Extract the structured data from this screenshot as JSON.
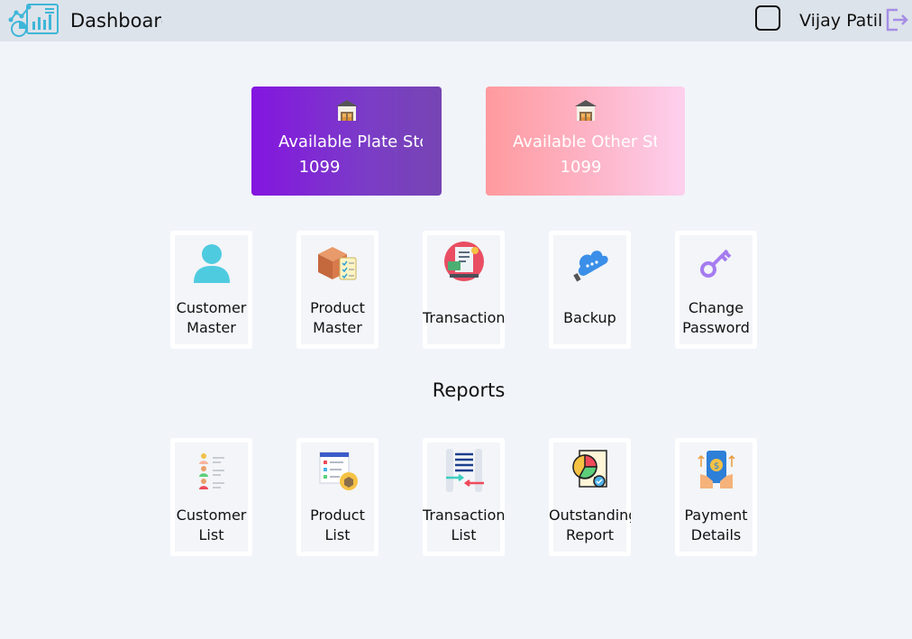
{
  "header": {
    "title": "Dashboard",
    "user_name": "Vijay Patil",
    "logo_icon": "dashboard-chart-icon",
    "logout_icon": "logout-icon"
  },
  "stats": [
    {
      "label": "Available Plate Stock",
      "value": "1099",
      "icon": "warehouse-icon"
    },
    {
      "label": "Available Other Stock",
      "value": "1099",
      "icon": "warehouse-icon"
    }
  ],
  "menu": [
    {
      "line1": "Customer",
      "line2": "Master",
      "icon": "user-icon"
    },
    {
      "line1": "Product",
      "line2": "Master",
      "icon": "product-box-icon"
    },
    {
      "line1": "Transaction",
      "line2": "",
      "icon": "transaction-icon"
    },
    {
      "line1": "Backup",
      "line2": "",
      "icon": "cloud-backup-icon"
    },
    {
      "line1": "Change",
      "line2": "Password",
      "icon": "key-icon"
    }
  ],
  "reports_title": "Reports",
  "reports": [
    {
      "line1": "Customer",
      "line2": "List",
      "icon": "customer-list-icon"
    },
    {
      "line1": "Product",
      "line2": "List",
      "icon": "product-list-icon"
    },
    {
      "line1": "Transaction",
      "line2": "List",
      "icon": "transaction-list-icon"
    },
    {
      "line1": "Outstanding",
      "line2": "Report",
      "icon": "pie-report-icon"
    },
    {
      "line1": "Payment",
      "line2": "Details",
      "icon": "payment-phone-icon"
    }
  ],
  "colors": {
    "header_bg": "#dde3ea",
    "page_bg": "#f1f4f9",
    "plate_card_start": "#8415e0",
    "plate_card_end": "#7645b3",
    "other_card_start": "#ff9a9e",
    "other_card_end": "#fdd0ee"
  }
}
